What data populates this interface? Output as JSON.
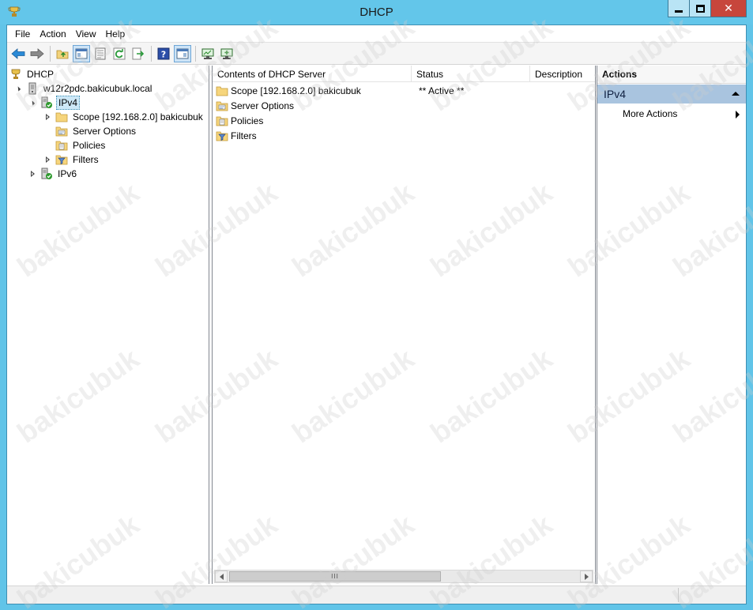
{
  "window": {
    "title": "DHCP",
    "close_glyph": "✕"
  },
  "menu": {
    "items": [
      "File",
      "Action",
      "View",
      "Help"
    ]
  },
  "toolbar": {
    "buttons": [
      "back-arrow-icon",
      "forward-arrow-icon",
      "up-folder-icon",
      "show-hide-tree-icon",
      "properties-icon",
      "refresh-icon",
      "export-list-icon",
      "help-icon",
      "show-hide-action-pane-icon",
      "server-statistics-icon",
      "add-server-icon"
    ]
  },
  "tree": {
    "root": "DHCP",
    "server": "w12r2pdc.bakicubuk.local",
    "ipv4": "IPv4",
    "scope": "Scope [192.168.2.0] bakicubuk",
    "server_options": "Server Options",
    "policies": "Policies",
    "filters": "Filters",
    "ipv6": "IPv6"
  },
  "list": {
    "columns": [
      "Contents of DHCP Server",
      "Status",
      "Description"
    ],
    "rows": [
      {
        "name": "Scope [192.168.2.0] bakicubuk",
        "status": "** Active **",
        "icon": "folder-icon"
      },
      {
        "name": "Server Options",
        "status": "",
        "icon": "server-options-icon"
      },
      {
        "name": "Policies",
        "status": "",
        "icon": "policies-icon"
      },
      {
        "name": "Filters",
        "status": "",
        "icon": "filters-icon"
      }
    ],
    "scroll_thumb_grip": "III"
  },
  "actions": {
    "title": "Actions",
    "group": "IPv4",
    "more_actions": "More Actions"
  },
  "watermark": "bakicubuk",
  "colors": {
    "titlebar": "#63c6ea",
    "close_button": "#c7463c",
    "actions_group": "#a9c4df",
    "selection": "#cde8f7"
  }
}
